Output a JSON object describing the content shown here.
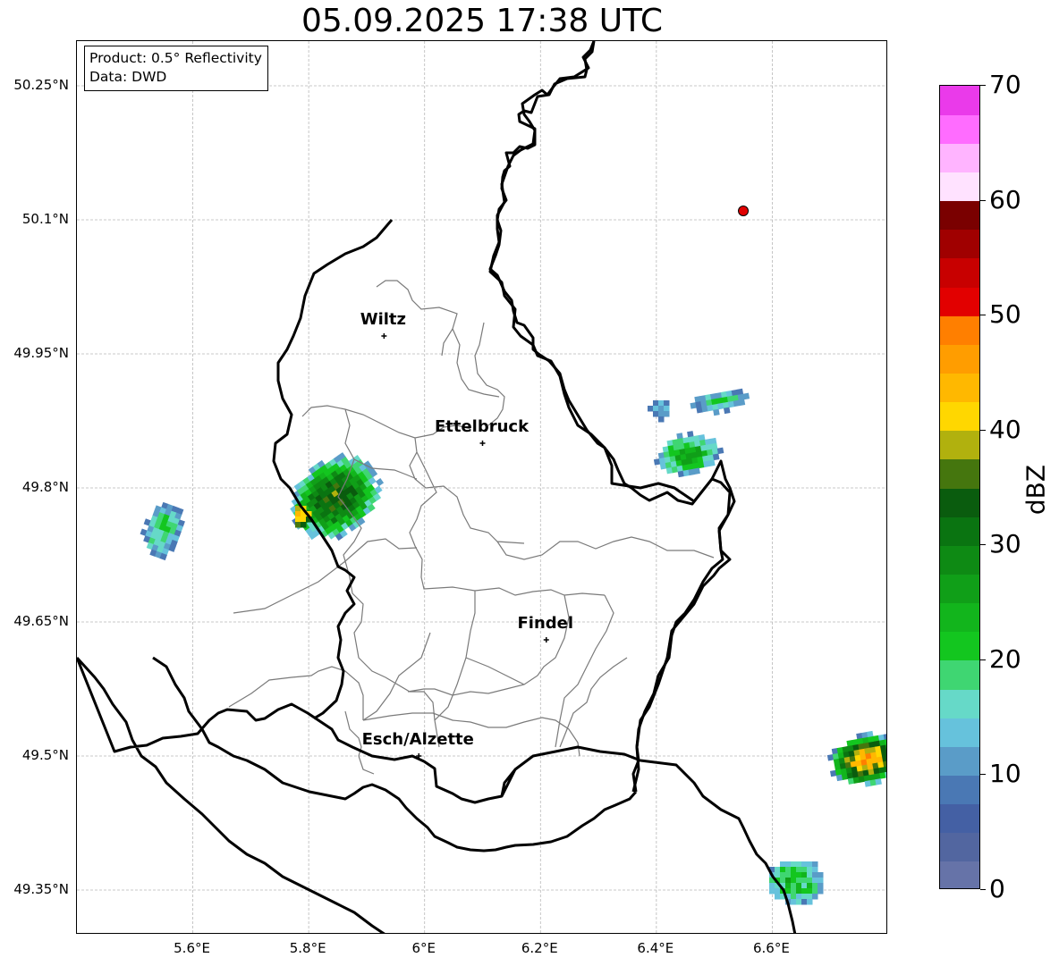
{
  "title": "05.09.2025 17:38 UTC",
  "info_box": {
    "product": "Product: 0.5° Reflectivity",
    "data_source": "Data: DWD"
  },
  "map": {
    "lon_range": [
      5.4,
      6.8
    ],
    "lat_range": [
      49.3,
      50.3
    ],
    "lat_ticks": [
      "50.25°N",
      "50.1°N",
      "49.95°N",
      "49.8°N",
      "49.65°N",
      "49.5°N",
      "49.35°N"
    ],
    "lon_ticks": [
      "5.6°E",
      "5.8°E",
      "6°E",
      "6.2°E",
      "6.4°E",
      "6.6°E"
    ],
    "grid": true,
    "marker_color": "#e00000",
    "cities": [
      {
        "name": "Wiltz",
        "lon": 5.93,
        "lat": 49.97
      },
      {
        "name": "Ettelbruck",
        "lon": 6.1,
        "lat": 49.85
      },
      {
        "name": "Findel",
        "lon": 6.21,
        "lat": 49.63
      },
      {
        "name": "Esch/Alzette",
        "lon": 5.99,
        "lat": 49.5
      }
    ],
    "station": {
      "lon": 6.55,
      "lat": 50.11
    }
  },
  "colorbar": {
    "label": "dBZ",
    "min": 0,
    "max": 70,
    "tick_labels": [
      "70",
      "60",
      "50",
      "40",
      "30",
      "20",
      "10",
      "0"
    ],
    "colors": [
      "#6673a8",
      "#5266a0",
      "#4460a4",
      "#4a78b4",
      "#5a9cc8",
      "#66c2dc",
      "#66d9c8",
      "#3fd672",
      "#13c61f",
      "#12b51c",
      "#109f18",
      "#0e8a14",
      "#0a7411",
      "#0a5c0e",
      "#45760e",
      "#b1b10e",
      "#ffd700",
      "#ffb800",
      "#ff9d00",
      "#ff7f00",
      "#e20000",
      "#c80000",
      "#a00000",
      "#7a0000",
      "#ffe2ff",
      "#ffb4ff",
      "#ff6cff",
      "#ea3aea"
    ]
  }
}
